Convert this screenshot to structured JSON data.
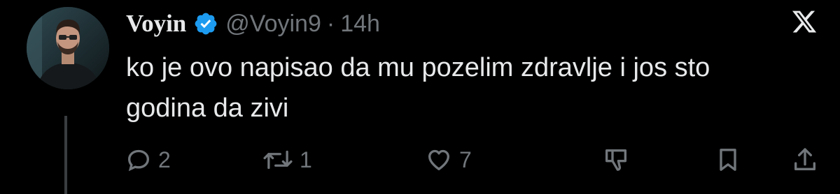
{
  "tweet": {
    "display_name": "Voyin",
    "handle": "@Voyin9",
    "separator": "·",
    "time": "14h",
    "verified": true,
    "text_line1": "ko je ovo napisao da mu pozelim zdravlje i jos sto",
    "text_line2": "godina da zivi"
  },
  "actions": {
    "reply_count": "2",
    "retweet_count": "1",
    "like_count": "7"
  },
  "icons": {
    "reply": "reply-icon",
    "retweet": "retweet-icon",
    "like": "heart-icon",
    "downvote": "thumbs-down-icon",
    "bookmark": "bookmark-icon",
    "share": "share-icon",
    "brand": "x-logo-icon",
    "verified": "verified-badge-icon"
  },
  "colors": {
    "background": "#000000",
    "text_primary": "#e7e9ea",
    "text_secondary": "#71767b",
    "verified_blue": "#1d9bf0"
  }
}
